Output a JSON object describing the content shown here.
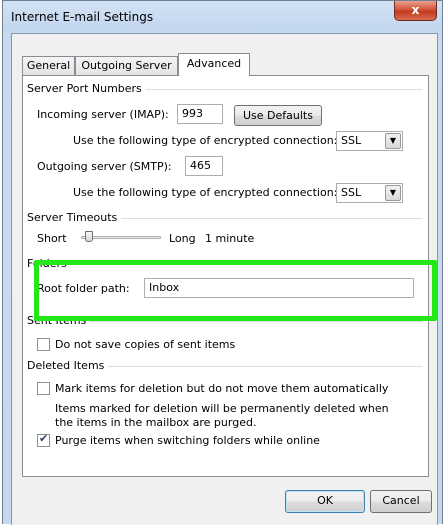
{
  "window": {
    "title": "Internet E-mail Settings",
    "close_glyph": "x"
  },
  "tabs": [
    {
      "label": "General",
      "active": false
    },
    {
      "label": "Outgoing Server",
      "active": false
    },
    {
      "label": "Advanced",
      "active": true
    }
  ],
  "server_ports": {
    "group_label": "Server Port Numbers",
    "incoming_label": "Incoming server (IMAP):",
    "incoming_value": "993",
    "use_defaults_label": "Use Defaults",
    "incoming_encryption_label": "Use the following type of encrypted connection:",
    "incoming_encryption_value": "SSL",
    "outgoing_label": "Outgoing server (SMTP):",
    "outgoing_value": "465",
    "outgoing_encryption_label": "Use the following type of encrypted connection:",
    "outgoing_encryption_value": "SSL"
  },
  "timeouts": {
    "group_label": "Server Timeouts",
    "short_label": "Short",
    "long_label": "Long",
    "value_label": "1 minute"
  },
  "folders": {
    "group_label": "Folders",
    "root_label": "Root folder path:",
    "root_value": "Inbox"
  },
  "sent_items": {
    "group_label": "Sent Items",
    "do_not_save_label": "Do not save copies of sent items",
    "do_not_save_checked": false
  },
  "deleted_items": {
    "group_label": "Deleted Items",
    "mark_label": "Mark items for deletion but do not move them automatically",
    "mark_checked": false,
    "note_line1": "Items marked for deletion will be permanently deleted when",
    "note_line2": "the items in the mailbox are purged.",
    "purge_label": "Purge items when switching folders while online",
    "purge_checked": true
  },
  "buttons": {
    "ok_label": "OK",
    "cancel_label": "Cancel"
  },
  "colors": {
    "highlight": "#22e81a",
    "close_button": "#c23a1f"
  }
}
